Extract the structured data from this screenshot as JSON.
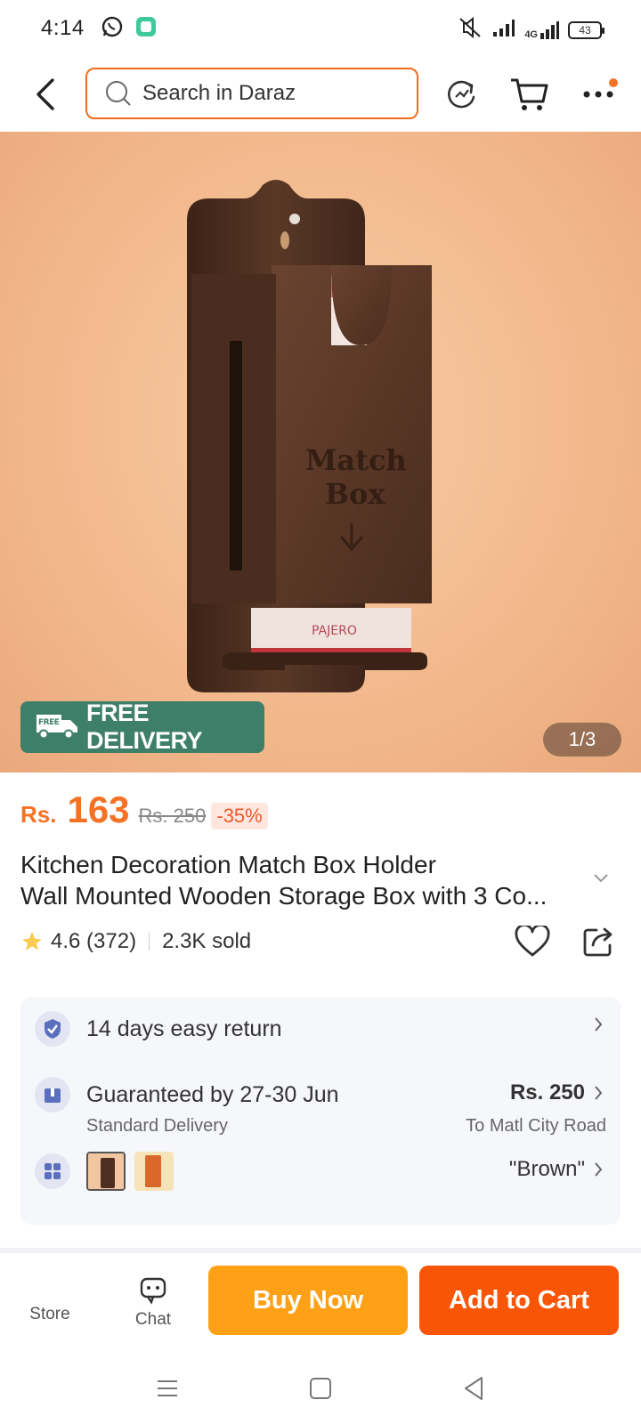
{
  "status_bar": {
    "time": "4:14",
    "battery": "43",
    "network": "4G"
  },
  "header": {
    "search_placeholder": "Search in Daraz"
  },
  "gallery": {
    "badge_text": "FREE DELIVERY",
    "badge_small": "FREE",
    "counter": "1/3"
  },
  "product": {
    "currency": "Rs.",
    "price": "163",
    "original_price": "Rs. 250",
    "discount": "-35%",
    "title_line1": "Kitchen Decoration Match Box Holder",
    "title_line2": "Wall Mounted Wooden Storage Box with 3 Co...",
    "rating": "4.6 (372)",
    "sold": "2.3K sold"
  },
  "info": {
    "return_text": "14 days easy return",
    "delivery_text": "Guaranteed by 27-30 Jun",
    "delivery_type": "Standard Delivery",
    "delivery_price": "Rs. 250",
    "delivery_location": "To Matl City Road",
    "variant_value": "\"Brown\""
  },
  "bottom_bar": {
    "store_label": "Store",
    "chat_label": "Chat",
    "buy_now": "Buy Now",
    "add_to_cart": "Add to Cart"
  },
  "colors": {
    "brand_orange": "#f85606",
    "buy_yellow": "#fea116",
    "badge_green": "#3e7f69"
  }
}
